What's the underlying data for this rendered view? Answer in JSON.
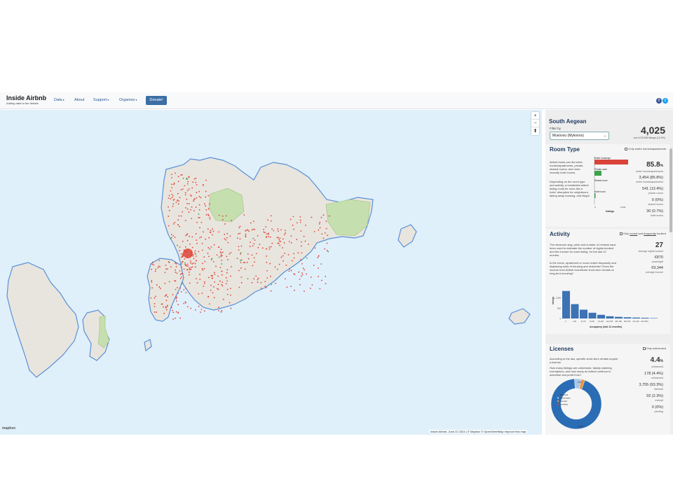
{
  "nav": {
    "brand_title": "Inside Airbnb",
    "brand_sub": "Adding data to the debate",
    "items": [
      {
        "label": "Data",
        "caret": "▾"
      },
      {
        "label": "About",
        "caret": ""
      },
      {
        "label": "Support",
        "caret": "▾"
      },
      {
        "label": "Organise",
        "caret": "▾"
      }
    ],
    "donate": "Donate!",
    "social": [
      {
        "icon": "facebook-icon",
        "glyph": "f",
        "color": "#3b5998"
      },
      {
        "icon": "twitter-icon",
        "glyph": "t",
        "color": "#1da1f2"
      }
    ]
  },
  "map": {
    "zoom_in": "+",
    "zoom_out": "−",
    "reset": "⬆",
    "attribution": "Inside Airbnb, June 22 2024 | © Mapbox © OpenStreetMap  Improve this map",
    "logo": "mapbox",
    "colors": {
      "water": "#dff0fb",
      "land": "#e8e5de",
      "park": "#c6dfae",
      "listing": "#e0463a",
      "hotel": "#3aa34a"
    }
  },
  "panel": {
    "region": "South Aegean",
    "filter_label": "Filter by",
    "filter_value": "Μυκόνου (Mykonos)",
    "total": "4,025",
    "total_sub": "out of 33,598 listings (12.0%)",
    "room_type": {
      "title": "Room Type",
      "checkbox": "Only entire homes/apartments",
      "desc1": "Airbnb hosts can list entire homes/apartments, private, shared rooms, and more recently hotel rooms.",
      "desc2": "Depending on the room type and activity, a residential airbnb listing could be more like a hotel, disruptive for neighbours, taking away housing, and illegal.",
      "bars": [
        {
          "label": "Entire home/apt",
          "value": 3454,
          "color": "#d9433a"
        },
        {
          "label": "Private room",
          "value": 541,
          "color": "#3aa34a"
        },
        {
          "label": "Shared room",
          "value": 0,
          "color": "#3aa34a"
        },
        {
          "label": "Hotel room",
          "value": 30,
          "color": "#3aa34a"
        }
      ],
      "axis_ticks": [
        "0",
        "2,000"
      ],
      "axis_label": "listings",
      "pct": "85.8",
      "pct_unit": "%",
      "pct_label": "entire homes/apartments",
      "stats": [
        {
          "value": "3,454 (85.8%)",
          "label": "entire homes/apartments"
        },
        {
          "value": "541 (13.4%)",
          "label": "private rooms"
        },
        {
          "value": "0 (0%)",
          "label": "shared rooms"
        },
        {
          "value": "30 (0.7%)",
          "label": "hotel rooms"
        }
      ]
    },
    "activity": {
      "title": "Activity",
      "checkbox_pre": "Only ",
      "checkbox_link1": "recent",
      "checkbox_mid": " and ",
      "checkbox_link2": "frequently",
      "checkbox_post": " booked",
      "desc1": "The minimum stay, price and number of reviews have been used to estimate the number of nights booked and the income for each listing, for the last 12 months.",
      "desc2": "Is the home, apartment or room rented frequently and displacing units of housing and residents? Does the income from Airbnb incentivise short-term rentals vs long-term housing?",
      "nights": "27",
      "nights_label": "average nights booked",
      "price": "€870",
      "price_label": "price/night",
      "income": "€9,344",
      "income_label": "average income",
      "hist_ylabel": "listings",
      "hist_yticks": [
        "1,000",
        "500",
        "0"
      ],
      "hist_xlabel": "occupancy (last 12 months)",
      "hist_xticks": [
        "0",
        "1-30",
        "31-60",
        "61-90",
        "91-120",
        "121-150",
        "151-180",
        "181-210",
        "211-240",
        "241-255+"
      ],
      "hist_values": [
        1340,
        700,
        430,
        280,
        180,
        110,
        80,
        60,
        45,
        35,
        20
      ]
    },
    "licenses": {
      "title": "Licenses",
      "checkbox": "Only unlicensed",
      "desc1": "According to the law, specific short-term rentals require a license.",
      "desc2": "How many listings are unlicensed, falsely claiming exemptions, and how many do Airbnb continue to advertise and profit from?",
      "pct": "4.4",
      "pct_unit": "%",
      "pct_label": "unlicensed",
      "stats": [
        {
          "value": "178 (4.4%)",
          "label": "unlicensed"
        },
        {
          "value": "3,755 (93.3%)",
          "label": "licensed"
        },
        {
          "value": "92 (2.3%)",
          "label": "exempt"
        },
        {
          "value": "0 (0%)",
          "label": "pending"
        }
      ],
      "donut": [
        {
          "label": "licensed",
          "value": 93.3,
          "color": "#2a6db5"
        },
        {
          "label": "unlicensed",
          "value": 4.4,
          "color": "#a9c7e8"
        },
        {
          "label": "exempt",
          "value": 2.3,
          "color": "#e8943a"
        },
        {
          "label": "pending",
          "value": 0,
          "color": "#d9433a"
        }
      ],
      "donut_label_bottom": "3,755",
      "donut_label_top": "178"
    }
  }
}
